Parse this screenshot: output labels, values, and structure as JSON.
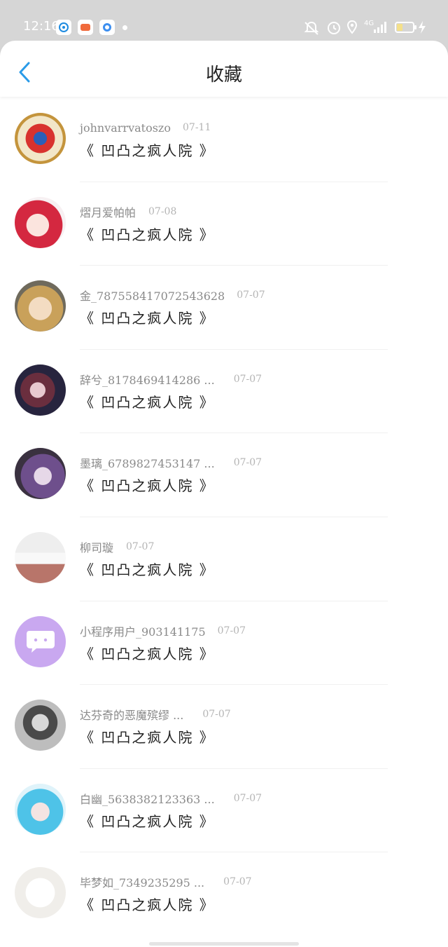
{
  "status_bar": {
    "time": "12:16",
    "network": "4G"
  },
  "header": {
    "title": "收藏"
  },
  "items": [
    {
      "username": "johnvarrvatoszo",
      "date": "07-11",
      "book": "《 凹凸之疯人院 》"
    },
    {
      "username": "熠月爱帕帕",
      "date": "07-08",
      "book": "《 凹凸之疯人院 》"
    },
    {
      "username": "金_787558417072543628",
      "date": "07-07",
      "book": "《 凹凸之疯人院 》"
    },
    {
      "username": "辞兮_8178469414286 ...",
      "date": "07-07",
      "book": "《 凹凸之疯人院 》"
    },
    {
      "username": "墨璃_6789827453147 ...",
      "date": "07-07",
      "book": "《 凹凸之疯人院 》"
    },
    {
      "username": "柳司璇",
      "date": "07-07",
      "book": "《 凹凸之疯人院 》"
    },
    {
      "username": "小程序用户_903141175",
      "date": "07-07",
      "book": "《 凹凸之疯人院 》"
    },
    {
      "username": "达芬奇的恶魔殡缪 ...",
      "date": "07-07",
      "book": "《 凹凸之疯人院 》"
    },
    {
      "username": "白幽_5638382123363 ...",
      "date": "07-07",
      "book": "《 凹凸之疯人院 》"
    },
    {
      "username": "毕梦如_7349235295 ...",
      "date": "07-07",
      "book": "《 凹凸之疯人院 》"
    }
  ],
  "colors": {
    "accent": "#2a9be8",
    "status_bar": "#d6d6d6",
    "text_primary": "#222222",
    "text_secondary": "#8a8a8a",
    "text_muted": "#b4b4b4"
  }
}
